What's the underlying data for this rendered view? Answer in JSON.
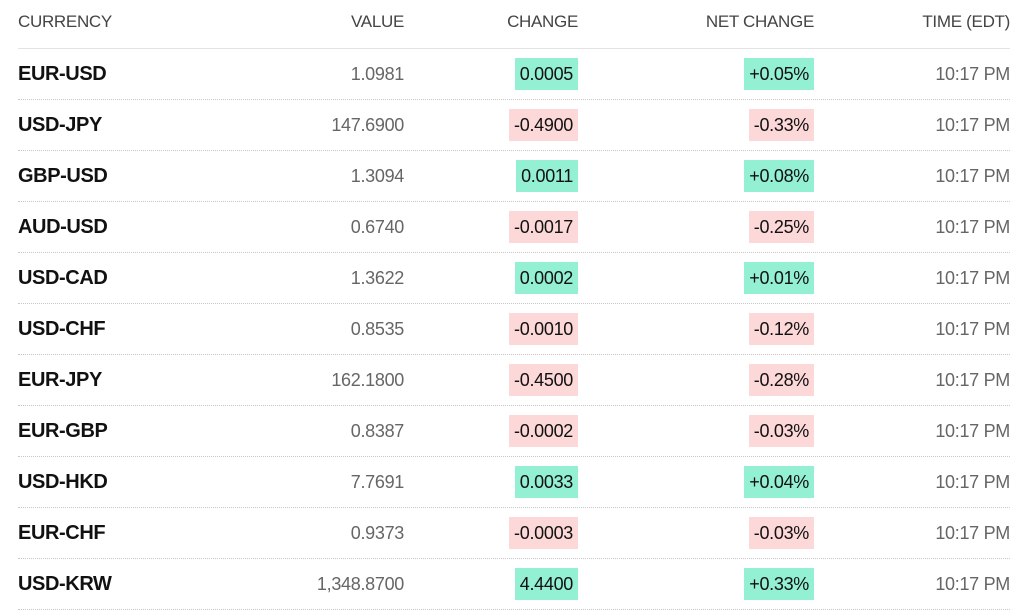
{
  "columns": {
    "currency": "CURRENCY",
    "value": "VALUE",
    "change": "CHANGE",
    "net_change": "NET CHANGE",
    "time": "TIME (EDT)"
  },
  "colors": {
    "positive_bg": "#93f0d3",
    "negative_bg": "#fdd8d8"
  },
  "rows": [
    {
      "pair": "EUR-USD",
      "value": "1.0981",
      "change": "0.0005",
      "net_change": "+0.05%",
      "time": "10:17 PM",
      "direction": "up"
    },
    {
      "pair": "USD-JPY",
      "value": "147.6900",
      "change": "-0.4900",
      "net_change": "-0.33%",
      "time": "10:17 PM",
      "direction": "down"
    },
    {
      "pair": "GBP-USD",
      "value": "1.3094",
      "change": "0.0011",
      "net_change": "+0.08%",
      "time": "10:17 PM",
      "direction": "up"
    },
    {
      "pair": "AUD-USD",
      "value": "0.6740",
      "change": "-0.0017",
      "net_change": "-0.25%",
      "time": "10:17 PM",
      "direction": "down"
    },
    {
      "pair": "USD-CAD",
      "value": "1.3622",
      "change": "0.0002",
      "net_change": "+0.01%",
      "time": "10:17 PM",
      "direction": "up"
    },
    {
      "pair": "USD-CHF",
      "value": "0.8535",
      "change": "-0.0010",
      "net_change": "-0.12%",
      "time": "10:17 PM",
      "direction": "down"
    },
    {
      "pair": "EUR-JPY",
      "value": "162.1800",
      "change": "-0.4500",
      "net_change": "-0.28%",
      "time": "10:17 PM",
      "direction": "down"
    },
    {
      "pair": "EUR-GBP",
      "value": "0.8387",
      "change": "-0.0002",
      "net_change": "-0.03%",
      "time": "10:17 PM",
      "direction": "down"
    },
    {
      "pair": "USD-HKD",
      "value": "7.7691",
      "change": "0.0033",
      "net_change": "+0.04%",
      "time": "10:17 PM",
      "direction": "up"
    },
    {
      "pair": "EUR-CHF",
      "value": "0.9373",
      "change": "-0.0003",
      "net_change": "-0.03%",
      "time": "10:17 PM",
      "direction": "down"
    },
    {
      "pair": "USD-KRW",
      "value": "1,348.8700",
      "change": "4.4400",
      "net_change": "+0.33%",
      "time": "10:17 PM",
      "direction": "up"
    }
  ]
}
